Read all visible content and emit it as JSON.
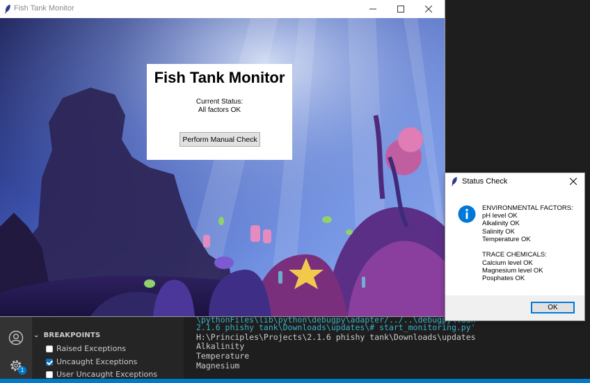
{
  "main_window": {
    "title": "Fish Tank Monitor",
    "panel": {
      "heading": "Fish Tank Monitor",
      "status_label": "Current Status:",
      "status_value": "All factors OK",
      "check_button": "Perform Manual Check"
    }
  },
  "dialog": {
    "title": "Status Check",
    "env_header": "ENVIRONMENTAL FACTORS:",
    "env_items": [
      "pH level OK",
      "Alkalinity OK",
      "Salinity OK",
      "Temperature OK"
    ],
    "trace_header": "TRACE CHEMICALS:",
    "trace_items": [
      "Calcium level OK",
      "Magnesium level OK",
      "Posphates OK"
    ],
    "ok_button": "OK"
  },
  "vscode": {
    "activity_badge": "1",
    "breakpoints": {
      "header": "BREAKPOINTS",
      "items": [
        {
          "label": "Raised Exceptions",
          "checked": false
        },
        {
          "label": "Uncaught Exceptions",
          "checked": true
        },
        {
          "label": "User Uncaught Exceptions",
          "checked": false
        }
      ]
    },
    "terminal": {
      "lines": [
        "\\pythonFiles\\lib\\python\\debugpy\\adapter/../..\\debugpy\\laun",
        "2.1.6 phishy tank\\Downloads\\updates\\# start_monitoring.py'",
        "H:\\Principles\\Projects\\2.1.6 phishy tank\\Downloads\\updates",
        "Alkalinity",
        "Temperature",
        "Magnesium"
      ]
    }
  },
  "colors": {
    "vscode_accent": "#007acc",
    "dialog_info": "#0078d7",
    "terminal_path": "#3ab0c9"
  }
}
